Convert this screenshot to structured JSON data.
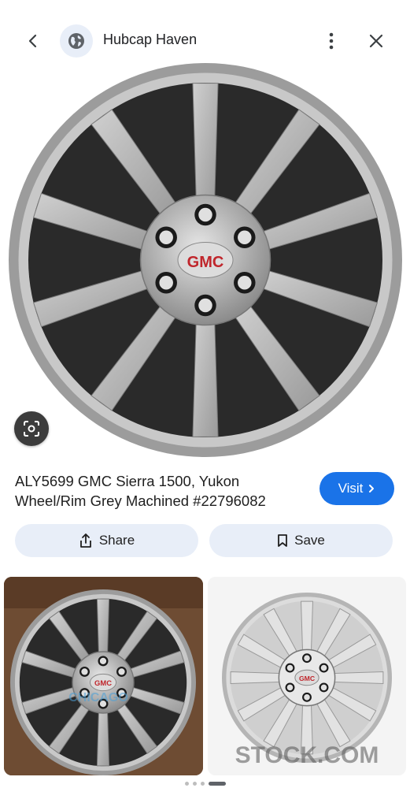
{
  "header": {
    "site_name": "Hubcap Haven",
    "back_icon": "arrow-back-icon",
    "site_icon": "globe-icon",
    "more_icon": "more-vert-icon",
    "close_icon": "close-icon"
  },
  "result": {
    "title": "ALY5699 GMC Sierra 1500, Yukon Wheel/Rim Grey Machined #22796082",
    "visit_label": "Visit",
    "share_label": "Share",
    "save_label": "Save",
    "wheel_logo": "GMC"
  },
  "related": [
    {
      "watermark_text": "CHICAGO",
      "logo": "GMC"
    },
    {
      "watermark_text": "STOCK.COM",
      "logo": "GMC"
    }
  ],
  "pager": {
    "count": 4,
    "active": 3
  },
  "colors": {
    "accent": "#1a73e8",
    "pill_bg": "#e8eef8"
  }
}
